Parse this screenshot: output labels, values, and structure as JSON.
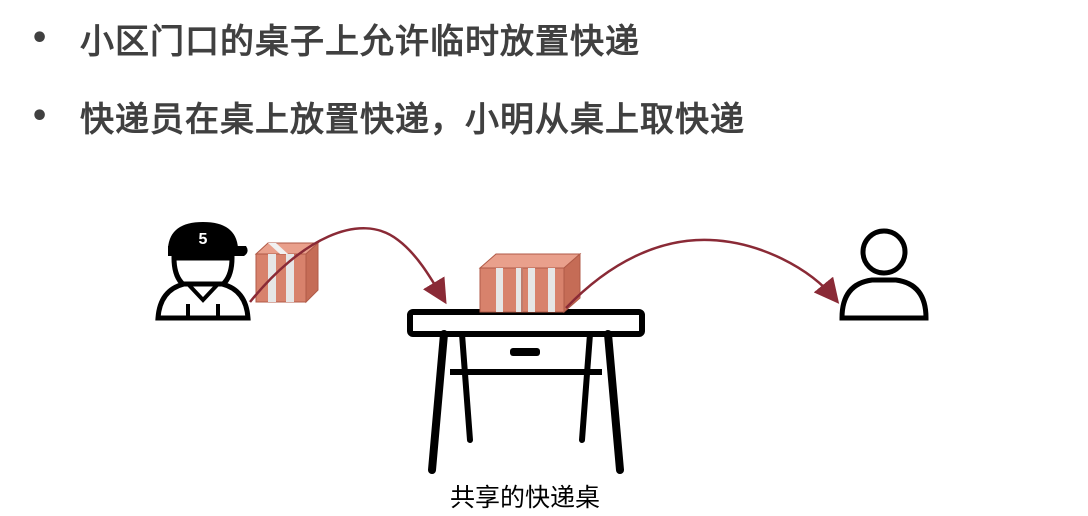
{
  "bullets": [
    {
      "text": "小区门口的桌子上允许临时放置快递"
    },
    {
      "text": "快递员在桌上放置快递，小明从桌上取快递"
    }
  ],
  "bullet_glyph": "•",
  "courier": {
    "cap_number": "5",
    "icon": "courier-icon"
  },
  "table_caption": "共享的快递桌",
  "colors": {
    "text": "#404040",
    "arrow": "#8a2a36",
    "box_light": "#e9a08c",
    "box_mid": "#d8826c",
    "box_dark": "#c56c56",
    "box_tape": "#e6e6e6",
    "outline": "#000000"
  },
  "icons": [
    "courier-icon",
    "package-icon",
    "table-icon",
    "person-icon",
    "arrow-icon"
  ]
}
